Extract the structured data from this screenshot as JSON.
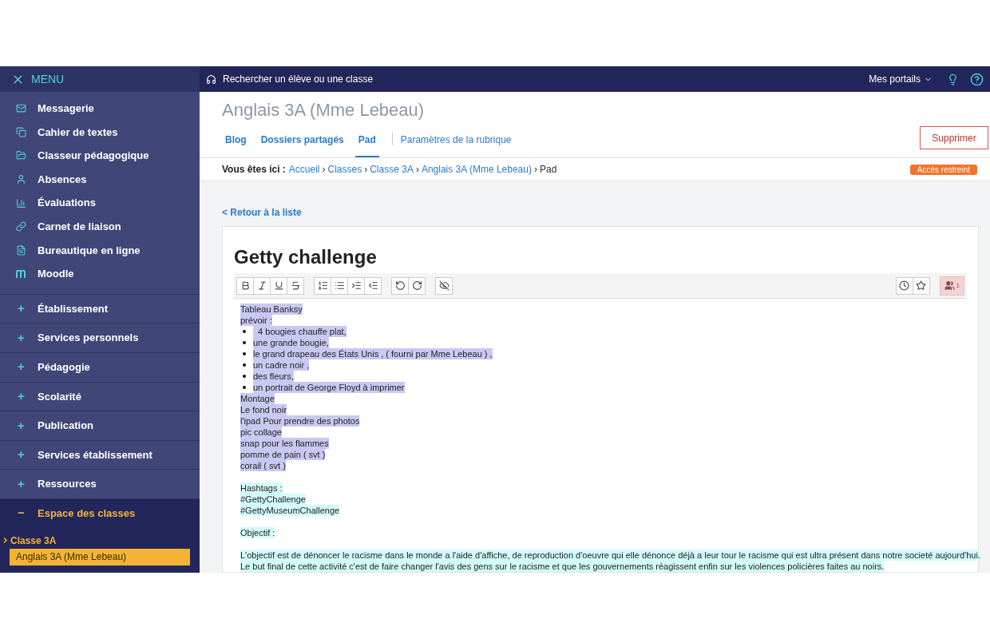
{
  "menu": {
    "title": "MENU"
  },
  "apps": [
    {
      "label": "Messagerie"
    },
    {
      "label": "Cahier de textes"
    },
    {
      "label": "Classeur pédagogique"
    },
    {
      "label": "Absences"
    },
    {
      "label": "Évaluations"
    },
    {
      "label": "Carnet de liaison"
    },
    {
      "label": "Bureautique en ligne"
    },
    {
      "label": "Moodle"
    }
  ],
  "sections": [
    {
      "sign": "+",
      "label": "Établissement",
      "expanded": false
    },
    {
      "sign": "+",
      "label": "Services personnels",
      "expanded": false
    },
    {
      "sign": "+",
      "label": "Pédagogie",
      "expanded": false
    },
    {
      "sign": "+",
      "label": "Scolarité",
      "expanded": false
    },
    {
      "sign": "+",
      "label": "Publication",
      "expanded": false
    },
    {
      "sign": "+",
      "label": "Services établissement",
      "expanded": false
    },
    {
      "sign": "+",
      "label": "Ressources",
      "expanded": false
    },
    {
      "sign": "−",
      "label": "Espace des classes",
      "expanded": true,
      "children": [
        {
          "label": "Classe 3A",
          "children": [
            {
              "label": "Anglais 3A (Mme Lebeau)",
              "selected": true
            }
          ]
        }
      ]
    }
  ],
  "topbar": {
    "search": "Rechercher un élève ou une classe",
    "portals": "Mes portails"
  },
  "page_title": "Anglais 3A (Mme Lebeau)",
  "tabs": [
    {
      "label": "Blog",
      "selected": false
    },
    {
      "label": "Dossiers partagés",
      "selected": false
    },
    {
      "label": "Pad",
      "selected": true
    },
    {
      "label": "Paramètres de la rubrique",
      "selected": false
    }
  ],
  "delete_button": "Supprimer",
  "breadcrumb": {
    "prefix": "Vous êtes ici :",
    "links": [
      "Accueil",
      "Classes",
      "Classe 3A",
      "Anglais 3A (Mme Lebeau)"
    ],
    "current": "Pad",
    "separator": "›"
  },
  "access_badge": "Accès restreint",
  "back_link": "< Retour à la liste",
  "pad": {
    "title": "Getty challenge",
    "users_count": "1",
    "lines": [
      {
        "kind": "text",
        "text": "Tableau Banksy",
        "color": "#c8c8f2"
      },
      {
        "kind": "text",
        "text": "prévoir :",
        "color": "#c8c8f2"
      },
      {
        "kind": "bullet",
        "text": "  4 bougies chauffe plat,",
        "color": "#c8c8f2"
      },
      {
        "kind": "bullet",
        "text": "une grande bougie,",
        "color": "#c8c8f2"
      },
      {
        "kind": "bullet",
        "text": "le grand drapeau des États Unis , ( fourni par Mme Lebeau ) ,",
        "color": "#c8c8f2"
      },
      {
        "kind": "bullet",
        "text": "un cadre noir ,",
        "color": "#c8c8f2"
      },
      {
        "kind": "bullet",
        "text": "des fleurs,",
        "color": "#c8c8f2"
      },
      {
        "kind": "bullet",
        "text": "un portrait de George Floyd à imprimer",
        "color": "#c8c8f2"
      },
      {
        "kind": "text",
        "text": "Montage",
        "color": "#c8c8f2"
      },
      {
        "kind": "text",
        "text": "Le fond noir",
        "color": "#c8c8f2"
      },
      {
        "kind": "text",
        "text": "l'ipad Pour prendre des photos",
        "color": "#c8c8f2"
      },
      {
        "kind": "text",
        "text": "pic collage",
        "color": "#c8c8f2"
      },
      {
        "kind": "text",
        "text": "snap pour les flammes",
        "color": "#c8c8f2"
      },
      {
        "kind": "text",
        "text": "pomme de pain ( svt )",
        "color": "#c8c8f2"
      },
      {
        "kind": "text",
        "text": "corail ( svt )",
        "color": "#c8c8f2"
      },
      {
        "kind": "blank"
      },
      {
        "kind": "text",
        "text": "Hashtags :",
        "color": "#d4fbfb"
      },
      {
        "kind": "text",
        "text": "#GettyChallenge",
        "color": "#d4fbfb"
      },
      {
        "kind": "text",
        "text": "#GettyMuseumChallenge",
        "color": "#d4fbfb"
      },
      {
        "kind": "blank"
      },
      {
        "kind": "text",
        "text": "Objectif :",
        "color": "#d4fbfb"
      },
      {
        "kind": "blank"
      },
      {
        "kind": "text",
        "text": "L'objectif est de dénoncer le racisme dans le monde a l'aide d'affiche, de reproduction d'oeuvre qui elle dénonce déjà a leur tour le racisme qui est ultra présent dans notre societé aujourd'hui.",
        "color": "#d4fbfb"
      },
      {
        "kind": "text",
        "text": "Le but final de cette activité c'est de faire changer l'avis des gens sur le racisme et que les gouvernements réagissent enfin sur les violences policières faites au noirs.",
        "color": "#d4fbfb"
      }
    ]
  }
}
